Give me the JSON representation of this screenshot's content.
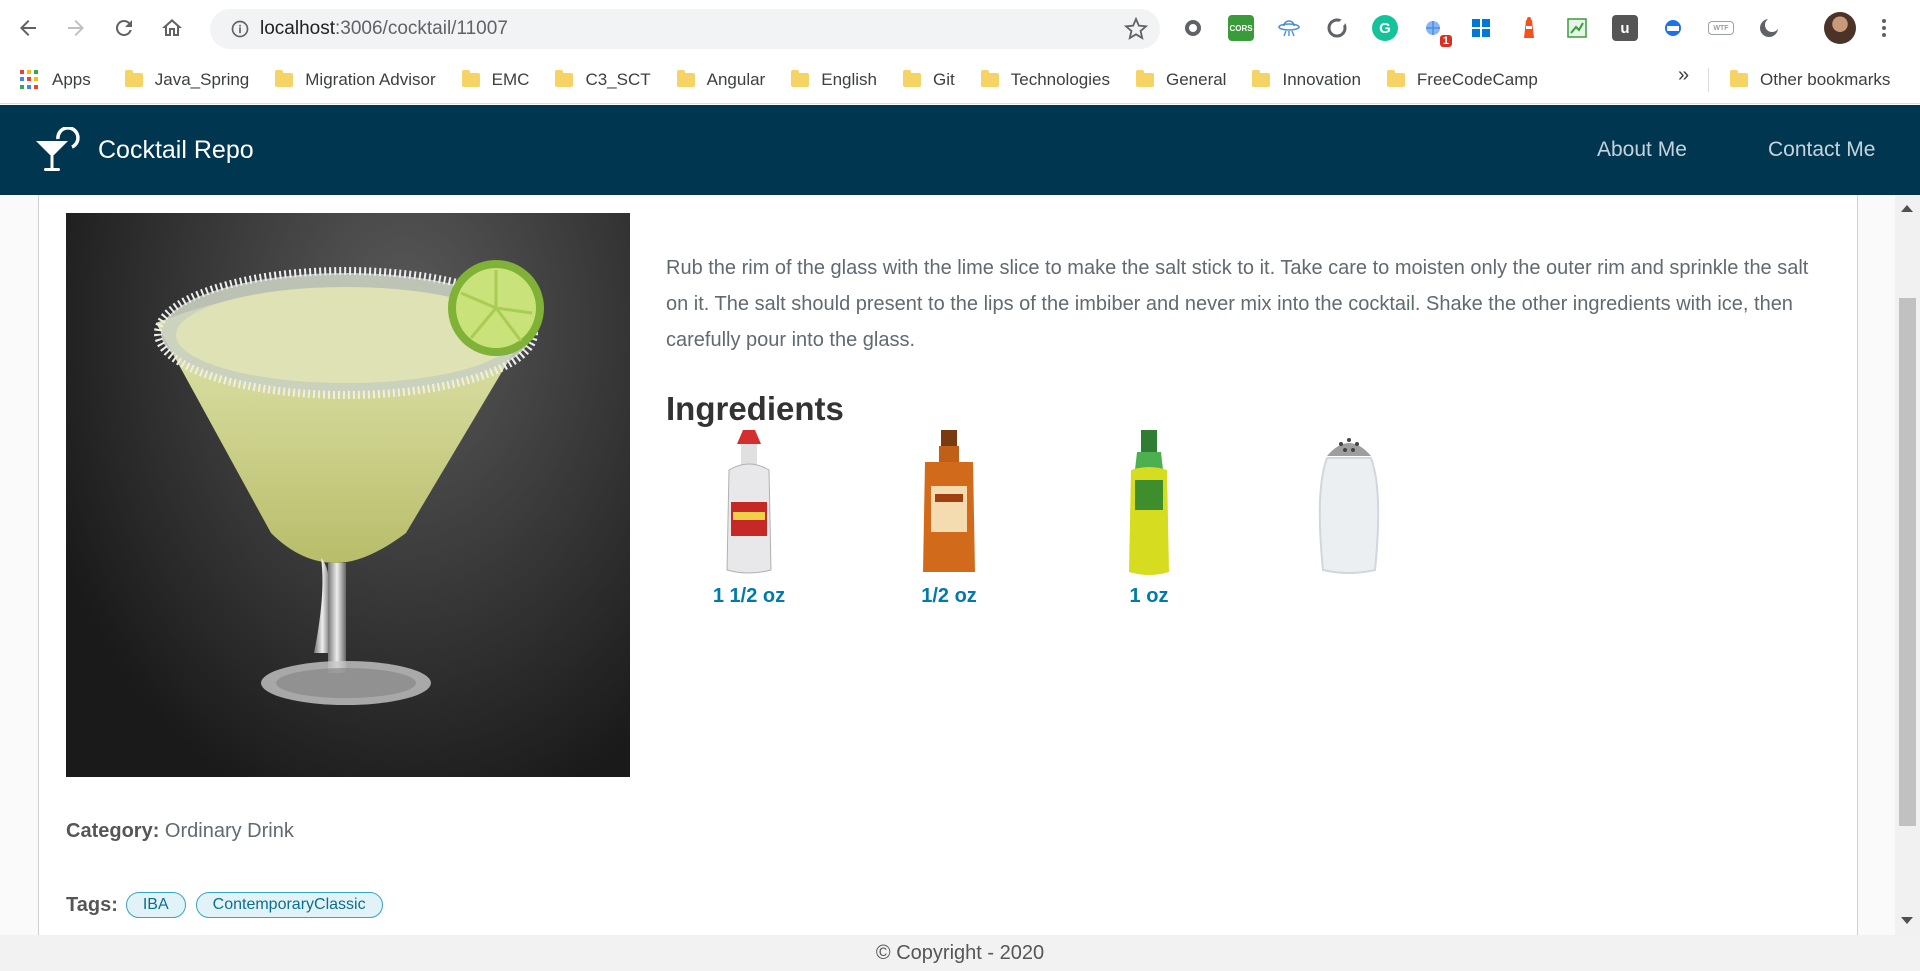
{
  "browser": {
    "url_host": "localhost",
    "url_path": ":3006/cocktail/11007",
    "extension_badge": "1",
    "extensions": [
      {
        "name": "extension-circle-icon",
        "color": "#5f6368",
        "label": ""
      },
      {
        "name": "cors-extension-icon",
        "color": "#3a9b3a",
        "label": "CORS"
      },
      {
        "name": "ufo-extension-icon",
        "color": "#4a90d9",
        "label": ""
      },
      {
        "name": "refresh-ext-icon",
        "color": "#5f6368",
        "label": ""
      },
      {
        "name": "grammarly-icon",
        "color": "#15c39a",
        "label": "G"
      },
      {
        "name": "bug-ext-icon",
        "color": "#4a90d9",
        "label": ""
      },
      {
        "name": "windows-icon",
        "color": "#0078d7",
        "label": ""
      },
      {
        "name": "lighthouse-icon",
        "color": "#f4511e",
        "label": ""
      },
      {
        "name": "spreadsheet-ext-icon",
        "color": "#3a9b3a",
        "label": ""
      },
      {
        "name": "u-ext-icon",
        "color": "#555555",
        "label": "u"
      },
      {
        "name": "globe-ext-icon",
        "color": "#1a73e8",
        "label": ""
      },
      {
        "name": "wtf-ext-icon",
        "color": "#9aa0a6",
        "label": "WTF"
      },
      {
        "name": "dark-mode-icon",
        "color": "#5f6368",
        "label": ""
      }
    ]
  },
  "bookmarks": {
    "apps_label": "Apps",
    "items": [
      "Java_Spring",
      "Migration Advisor",
      "EMC",
      "C3_SCT",
      "Angular",
      "English",
      "Git",
      "Technologies",
      "General",
      "Innovation",
      "FreeCodeCamp"
    ],
    "overflow": "»",
    "other": "Other bookmarks"
  },
  "header": {
    "brand": "Cocktail Repo",
    "nav": [
      "About Me",
      "Contact Me"
    ],
    "bg_color": "#00364f"
  },
  "drink": {
    "instructions": "Rub the rim of the glass with the lime slice to make the salt stick to it. Take care to moisten only the outer rim and sprinkle the salt on it. The salt should present to the lips of the imbiber and never mix into the cocktail. Shake the other ingredients with ice, then carefully pour into the glass.",
    "ingredients_title": "Ingredients",
    "ingredients": [
      {
        "name": "tequila-bottle",
        "measure": "1 1/2 oz"
      },
      {
        "name": "triple-sec-bottle",
        "measure": "1/2 oz"
      },
      {
        "name": "lime-juice-bottle",
        "measure": "1 oz"
      },
      {
        "name": "salt-shaker",
        "measure": ""
      }
    ],
    "category_label": "Category:",
    "category_value": "Ordinary Drink",
    "tags_label": "Tags:",
    "tags": [
      "IBA",
      "ContemporaryClassic"
    ]
  },
  "footer": {
    "text": "© Copyright - 2020"
  }
}
